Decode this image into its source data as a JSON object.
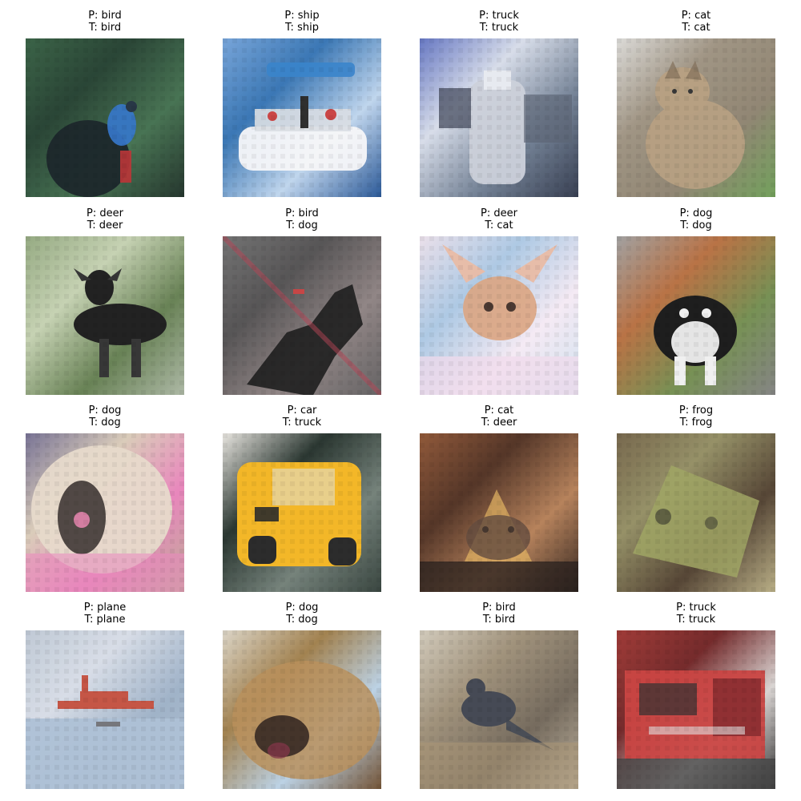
{
  "items": [
    {
      "pred": "P: bird",
      "truth": "T: bird",
      "bg": [
        "#2f5a3c",
        "#1d3a2a",
        "#3d6b49",
        "#182a21"
      ],
      "subject": "bird",
      "accent": "#2a6fc9",
      "accent2": "#b7292b"
    },
    {
      "pred": "P: ship",
      "truth": "T: ship",
      "bg": [
        "#6f9fd6",
        "#2f6fb0",
        "#bcd3ec",
        "#1e4f91"
      ],
      "subject": "ship",
      "accent": "#f5f6f8",
      "accent2": "#c73a3a"
    },
    {
      "pred": "P: truck",
      "truth": "T: truck",
      "bg": [
        "#5d6fbf",
        "#d5dbe8",
        "#6b7a8f",
        "#2c3448"
      ],
      "subject": "truck",
      "accent": "#c9ced8",
      "accent2": "#3b4256"
    },
    {
      "pred": "P: cat",
      "truth": "T: cat",
      "bg": [
        "#d9d8d5",
        "#9a8e7c",
        "#8a7f6b",
        "#6a9b52"
      ],
      "subject": "cat",
      "accent": "#b29a7a",
      "accent2": "#7a6650"
    },
    {
      "pred": "P: deer",
      "truth": "T: deer",
      "bg": [
        "#8fa57b",
        "#c2cfae",
        "#5f7a4b",
        "#a8b4a0"
      ],
      "subject": "deer",
      "accent": "#141414",
      "accent2": "#2b2b2b"
    },
    {
      "pred": "P: bird",
      "truth": "T: dog",
      "bg": [
        "#6a6a6a",
        "#4d4b4c",
        "#8a7e7e",
        "#5c5a5b"
      ],
      "subject": "dog-dark",
      "accent": "#141414",
      "accent2": "#c23a3a"
    },
    {
      "pred": "P: deer",
      "truth": "T: cat",
      "bg": [
        "#e9dee9",
        "#a9c6e2",
        "#f4e9f3",
        "#cfe0ef"
      ],
      "subject": "cat-light",
      "accent": "#d9a07a",
      "accent2": "#e8b7a0"
    },
    {
      "pred": "P: dog",
      "truth": "T: dog",
      "bg": [
        "#9b9b9b",
        "#b56a3a",
        "#6f8a4a",
        "#7d7d7d"
      ],
      "subject": "dog-spotted",
      "accent": "#101010",
      "accent2": "#efefef"
    },
    {
      "pred": "P: dog",
      "truth": "T: dog",
      "bg": [
        "#6f6a8e",
        "#d8c9b6",
        "#e77fb8",
        "#b9a890"
      ],
      "subject": "dog-fluffy",
      "accent": "#2a2220",
      "accent2": "#e5d8c8"
    },
    {
      "pred": "P: car",
      "truth": "T: truck",
      "bg": [
        "#e7e4de",
        "#1d2a24",
        "#6d7b73",
        "#2d3a34"
      ],
      "subject": "truck-yellow",
      "accent": "#f2b31b",
      "accent2": "#1f1f1f"
    },
    {
      "pred": "P: cat",
      "truth": "T: deer",
      "bg": [
        "#8a4f2e",
        "#4a2a1b",
        "#b27b52",
        "#2a1b14"
      ],
      "subject": "deer-face",
      "accent": "#e3b15a",
      "accent2": "#3a2a22"
    },
    {
      "pred": "P: frog",
      "truth": "T: frog",
      "bg": [
        "#6f5f43",
        "#8f8a5e",
        "#4c3b2a",
        "#b5aa7f"
      ],
      "subject": "frog",
      "accent": "#9aa05b",
      "accent2": "#3b3b2a"
    },
    {
      "pred": "P: plane",
      "truth": "T: plane",
      "bg": [
        "#bcc6d3",
        "#d5dbe5",
        "#9aaec5",
        "#a7b8cc"
      ],
      "subject": "plane",
      "accent": "#c14b3a",
      "accent2": "#6d6f74"
    },
    {
      "pred": "P: dog",
      "truth": "T: dog",
      "bg": [
        "#d9d2c3",
        "#9c7a45",
        "#b8cfe3",
        "#6b4a2a"
      ],
      "subject": "dog-closeup",
      "accent": "#2a1c16",
      "accent2": "#b58a52"
    },
    {
      "pred": "P: bird",
      "truth": "T: bird",
      "bg": [
        "#cfc7b7",
        "#9b8c74",
        "#6d6254",
        "#b9ad98"
      ],
      "subject": "bird-ground",
      "accent": "#3a3f4a",
      "accent2": "#a5a09a"
    },
    {
      "pred": "P: truck",
      "truth": "T: truck",
      "bg": [
        "#9a2f2b",
        "#6c1e1f",
        "#d7d2d0",
        "#2a2a2a"
      ],
      "subject": "firetruck",
      "accent": "#c73a38",
      "accent2": "#dddddd"
    }
  ]
}
